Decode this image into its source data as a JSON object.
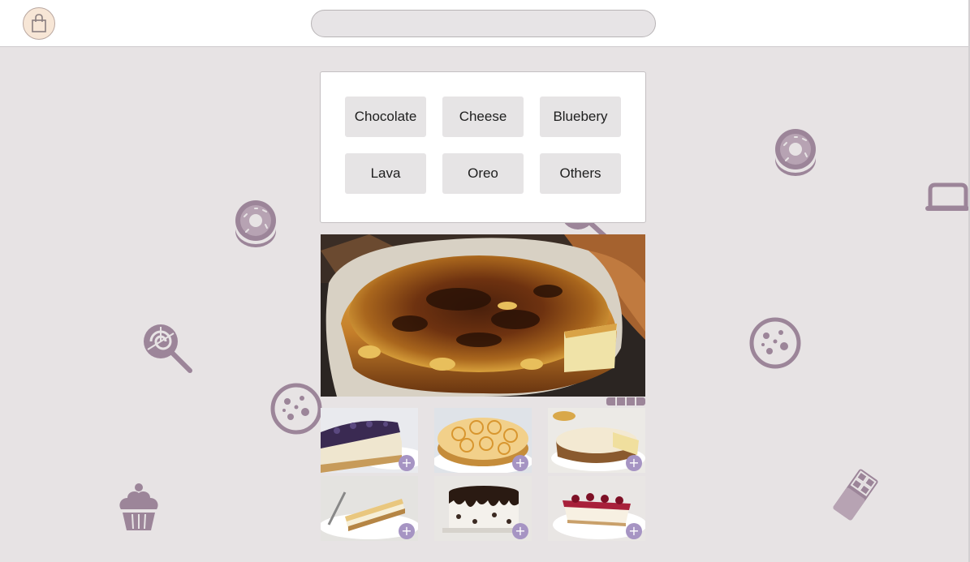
{
  "header": {
    "cart_icon": "shopping-bag-icon",
    "search": {
      "value": "",
      "placeholder": ""
    }
  },
  "categories": [
    {
      "label": "Chocolate"
    },
    {
      "label": "Cheese"
    },
    {
      "label": "Bluebery"
    },
    {
      "label": "Lava"
    },
    {
      "label": "Oreo"
    },
    {
      "label": "Others"
    }
  ],
  "hero": {
    "image": "basque-burnt-cheesecake-photo"
  },
  "products": [
    {
      "image": "blueberry-cheesecake-photo",
      "add_label": "+"
    },
    {
      "image": "meringue-rose-cake-photo",
      "add_label": "+"
    },
    {
      "image": "banoffee-pie-photo",
      "add_label": "+"
    },
    {
      "image": "plain-cheesecake-slice-photo",
      "add_label": "+"
    },
    {
      "image": "oreo-drip-cake-photo",
      "add_label": "+"
    },
    {
      "image": "cherry-cheesecake-slice-photo",
      "add_label": "+"
    }
  ],
  "decorations": [
    "donut-icon",
    "donut-icon",
    "lollipop-icon",
    "lollipop-icon",
    "cookie-icon",
    "cookie-icon",
    "cupcake-icon",
    "chocolate-bar-icon",
    "cake-icon"
  ],
  "colors": {
    "accent": "#a694c3",
    "decoration": "#9c8599",
    "background": "#e7e3e4"
  }
}
